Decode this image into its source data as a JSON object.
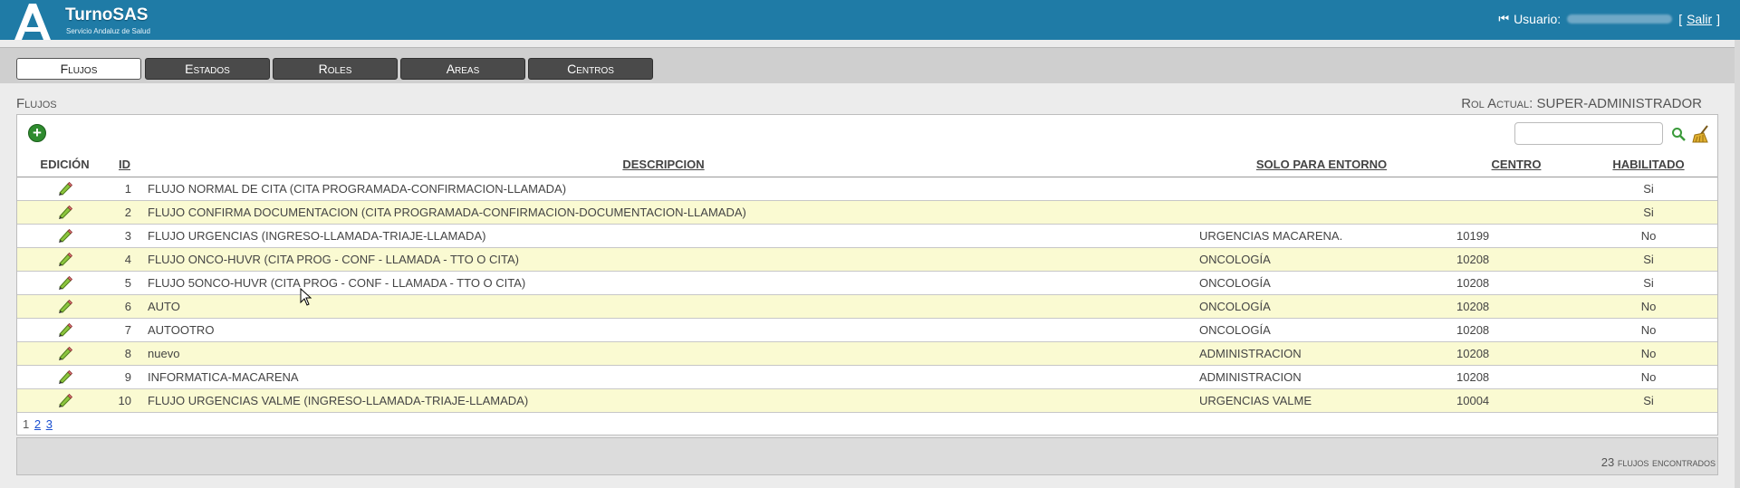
{
  "app": {
    "title": "TurnoSAS",
    "subtitle": "Servicio Andaluz de Salud"
  },
  "user": {
    "label": "Usuario:",
    "logout_open": "[",
    "logout": "Salir",
    "logout_close": "]",
    "first_icon": "first-page-icon"
  },
  "tabs": [
    {
      "label": "Flujos",
      "active": true
    },
    {
      "label": "Estados",
      "active": false
    },
    {
      "label": "Roles",
      "active": false
    },
    {
      "label": "Areas",
      "active": false
    },
    {
      "label": "Centros",
      "active": false
    }
  ],
  "section": {
    "title": "Flujos",
    "rol_label": "Rol Actual:",
    "rol_value": "SUPER-ADMINISTRADOR"
  },
  "toolbar": {
    "add_icon": "add-icon",
    "search_placeholder": "",
    "search_icon": "search-icon",
    "clear_icon": "clear-broom-icon"
  },
  "table": {
    "columns": [
      "EDICIÓN",
      "ID",
      "DESCRIPCION",
      "SOLO PARA ENTORNO",
      "CENTRO",
      "HABILITADO"
    ],
    "rows": [
      {
        "id": "1",
        "descripcion": "FLUJO NORMAL DE CITA (CITA PROGRAMADA-CONFIRMACION-LLAMADA)",
        "entorno": "",
        "centro": "",
        "habilitado": "Si"
      },
      {
        "id": "2",
        "descripcion": "FLUJO CONFIRMA DOCUMENTACION (CITA PROGRAMADA-CONFIRMACION-DOCUMENTACION-LLAMADA)",
        "entorno": "",
        "centro": "",
        "habilitado": "Si"
      },
      {
        "id": "3",
        "descripcion": "FLUJO URGENCIAS (INGRESO-LLAMADA-TRIAJE-LLAMADA)",
        "entorno": "URGENCIAS MACARENA.",
        "centro": "10199",
        "habilitado": "No"
      },
      {
        "id": "4",
        "descripcion": "FLUJO ONCO-HUVR (CITA PROG - CONF - LLAMADA - TTO O CITA)",
        "entorno": "ONCOLOGÍA",
        "centro": "10208",
        "habilitado": "Si"
      },
      {
        "id": "5",
        "descripcion": "FLUJO 5ONCO-HUVR (CITA PROG - CONF - LLAMADA - TTO O CITA)",
        "entorno": "ONCOLOGÍA",
        "centro": "10208",
        "habilitado": "Si"
      },
      {
        "id": "6",
        "descripcion": "AUTO",
        "entorno": "ONCOLOGÍA",
        "centro": "10208",
        "habilitado": "No"
      },
      {
        "id": "7",
        "descripcion": "AUTOOTRO",
        "entorno": "ONCOLOGÍA",
        "centro": "10208",
        "habilitado": "No"
      },
      {
        "id": "8",
        "descripcion": "nuevo",
        "entorno": "ADMINISTRACION",
        "centro": "10208",
        "habilitado": "No"
      },
      {
        "id": "9",
        "descripcion": "INFORMATICA-MACARENA",
        "entorno": "ADMINISTRACION",
        "centro": "10208",
        "habilitado": "No"
      },
      {
        "id": "10",
        "descripcion": "FLUJO URGENCIAS VALME (INGRESO-LLAMADA-TRIAJE-LLAMADA)",
        "entorno": "URGENCIAS VALME",
        "centro": "10004",
        "habilitado": "Si"
      }
    ]
  },
  "pager": {
    "current": "1",
    "pages": [
      "2",
      "3"
    ]
  },
  "footer": {
    "found": "23 flujos encontrados"
  },
  "colors": {
    "header": "#1f7ba6",
    "tab": "#4a4a4a",
    "alt_row": "#fafad2",
    "add_green": "#2e8b2e"
  }
}
